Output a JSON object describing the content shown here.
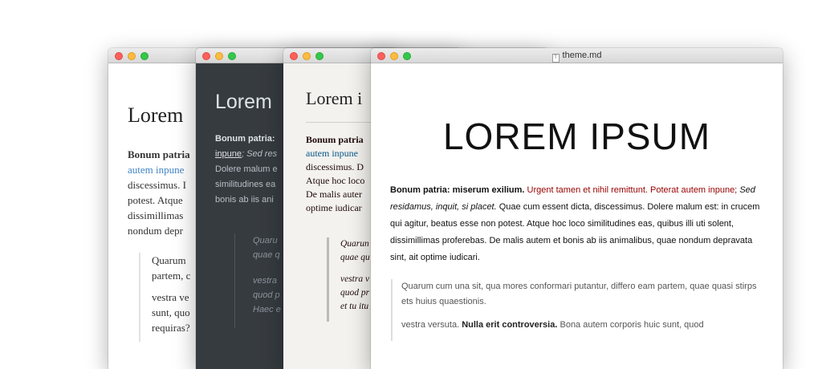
{
  "windows": {
    "w1": {
      "heading": "Lorem",
      "para_bold": "Bonum patria",
      "para_link": "autem inpune",
      "para_lines": [
        "discessimus. I",
        "potest. Atque",
        "dissimillimas",
        "nondum depr"
      ],
      "quote_lines": [
        "Quarum",
        "partem, c",
        "vestra ve",
        "sunt, quo",
        "requiras?"
      ]
    },
    "w2": {
      "heading": "Lorem",
      "para_bold": "Bonum patria:",
      "para_link": "inpune",
      "para_link_rest": "; Sed res",
      "para_lines": [
        "Dolere malum e",
        "similitudines ea",
        "bonis ab iis ani"
      ],
      "quote_lines": [
        "Quaru",
        "quae q",
        "vestra",
        "quod p",
        "Haec e"
      ]
    },
    "w3": {
      "heading": "Lorem i",
      "para_bold": "Bonum patria",
      "para_link": "autem inpune",
      "para_lines": [
        "discessimus. D",
        "Atque hoc loco",
        "De malis auter",
        "optime iudicar"
      ],
      "quote_lines": [
        "Quarun",
        "quae qu",
        "vestra v",
        "quod pr",
        "et tu itu"
      ]
    },
    "w4": {
      "title": "theme.md",
      "heading": "LOREM IPSUM",
      "para_bold": "Bonum patria: miserum exilium.",
      "para_red": "Urgent tamen et nihil remittunt. Poterat autem inpune;",
      "para_italic": "Sed residamus, inquit, si placet.",
      "para_rest": "Quae cum essent dicta, discessimus. Dolere malum est: in crucem qui agitur, beatus esse non potest. Atque hoc loco similitudines eas, quibus illi uti solent, dissimillimas proferebas. De malis autem et bonis ab iis animalibus, quae nondum depravata sint, ait optime iudicari.",
      "quote1": "Quarum cum una sit, qua mores conformari putantur, differo eam partem, quae quasi stirps ets huius quaestionis.",
      "quote2_a": "vestra versuta.",
      "quote2_bold": "Nulla erit controversia.",
      "quote2_b": "Bona autem corporis huic sunt, quod"
    }
  },
  "colors": {
    "link_blue": "#4183c4",
    "dark_bg": "#363b40",
    "newsprint_bg": "#f3f2ee",
    "accent_red": "#990000"
  }
}
